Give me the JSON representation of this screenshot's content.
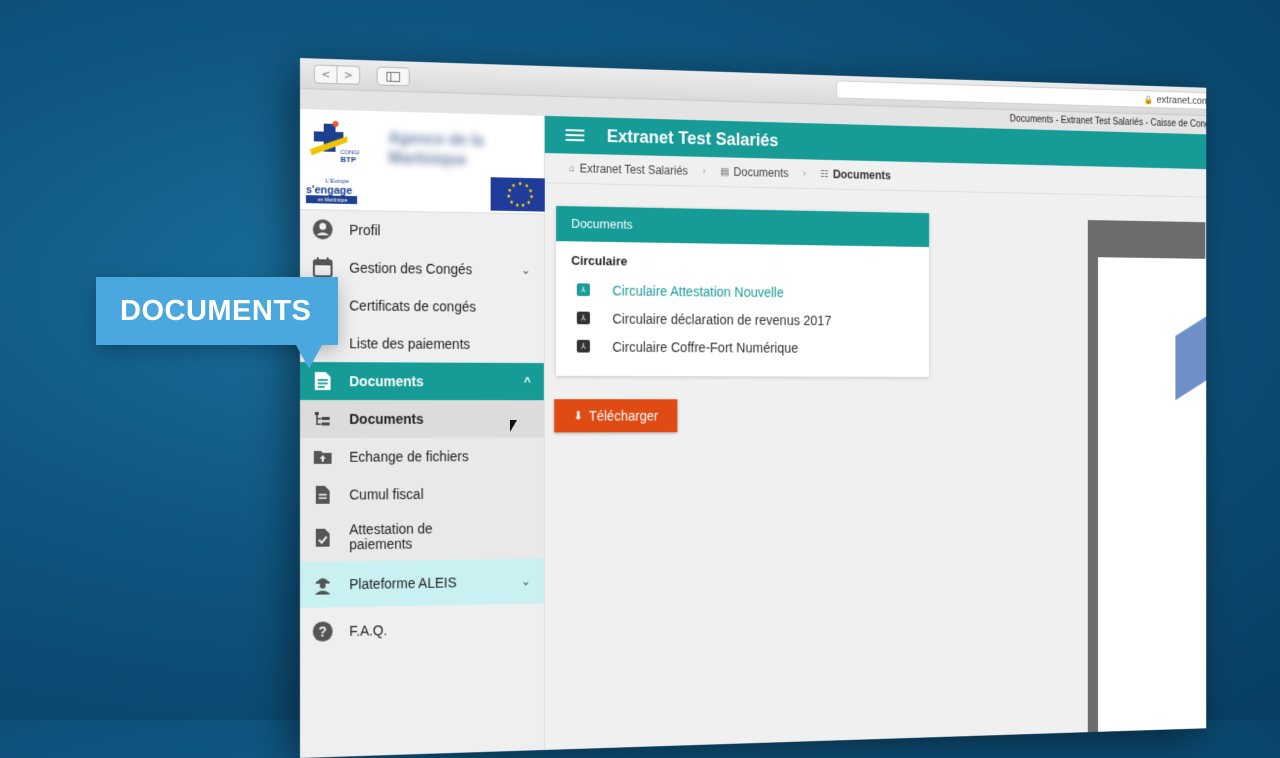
{
  "browser": {
    "url": "extranet.con",
    "tab_title": "Documents - Extranet Test Salariés - Caisse de Congés Pa",
    "back_glyph": "<",
    "forward_glyph": ">"
  },
  "logos": {
    "conges_btp": "CONGES BTP",
    "engage": "L'Europe s'engage en Martinique"
  },
  "sidebar": {
    "items": [
      {
        "label": "Profil",
        "icon": "user-circle-icon"
      },
      {
        "label": "Gestion des Congés",
        "icon": "calendar-icon",
        "chevron": "⌄"
      },
      {
        "label": "Certificats de congés"
      },
      {
        "label": "Liste des paiements"
      },
      {
        "label": "Documents",
        "icon": "document-icon",
        "chevron": "^"
      },
      {
        "label": "Documents",
        "icon": "folder-tree-icon"
      },
      {
        "label": "Echange de fichiers",
        "icon": "folder-upload-icon"
      },
      {
        "label": "Cumul fiscal",
        "icon": "file-text-icon"
      },
      {
        "label": "Attestation de paiements",
        "icon": "file-check-icon"
      },
      {
        "label": "Plateforme ALEIS",
        "icon": "worker-icon",
        "chevron": "⌄"
      },
      {
        "label": "F.A.Q.",
        "icon": "help-icon"
      }
    ]
  },
  "header": {
    "title": "Extranet Test Salariés"
  },
  "breadcrumb": {
    "home": "Extranet Test Salariés",
    "section": "Documents",
    "current": "Documents"
  },
  "card": {
    "header": "Documents",
    "section_title": "Circulaire",
    "documents": [
      {
        "label": "Circulaire Attestation Nouvelle",
        "link": true
      },
      {
        "label": "Circulaire déclaration de revenus 2017",
        "link": false
      },
      {
        "label": "Circulaire Coffre-Fort Numérique",
        "link": false
      }
    ]
  },
  "download_button": {
    "label": "Télécharger"
  },
  "callout": {
    "label": "DOCUMENTS"
  },
  "colors": {
    "teal": "#169b97",
    "download_orange": "#e04a13",
    "callout_blue": "#4aa8de",
    "aleis_bg": "#c9f1f1"
  }
}
